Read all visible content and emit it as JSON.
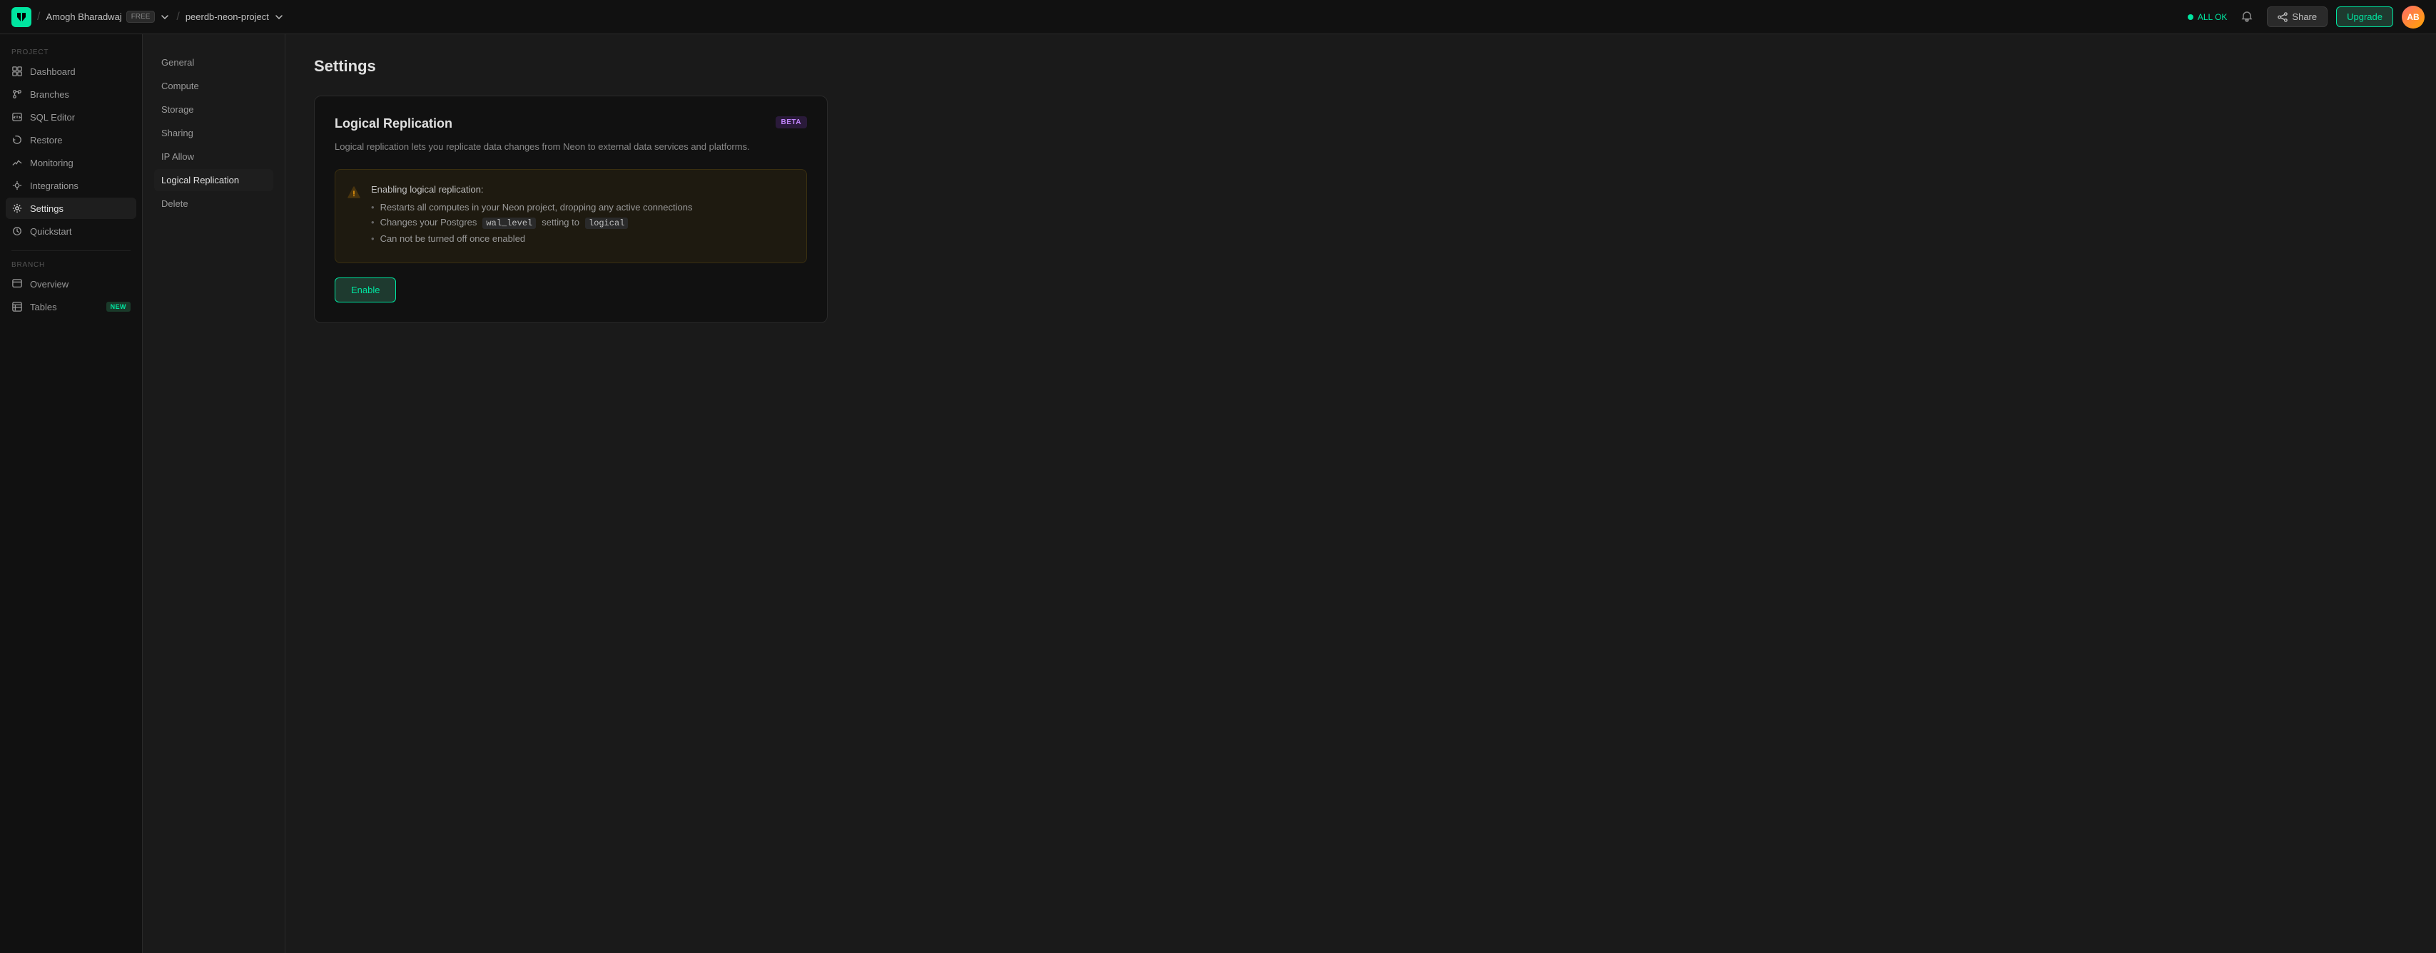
{
  "topNav": {
    "logo": "N",
    "user": {
      "name": "Amogh Bharadwaj",
      "badge": "FREE"
    },
    "project": {
      "name": "peerdb-neon-project"
    },
    "status": {
      "label": "ALL OK",
      "dot_color": "#00e5a0"
    },
    "share_label": "Share",
    "upgrade_label": "Upgrade",
    "avatar_initials": "AB"
  },
  "sidebar": {
    "project_label": "PROJECT",
    "branch_label": "BRANCH",
    "items_project": [
      {
        "id": "dashboard",
        "label": "Dashboard",
        "icon": "dashboard"
      },
      {
        "id": "branches",
        "label": "Branches",
        "icon": "branches"
      },
      {
        "id": "sql-editor",
        "label": "SQL Editor",
        "icon": "sql-editor"
      },
      {
        "id": "restore",
        "label": "Restore",
        "icon": "restore"
      },
      {
        "id": "monitoring",
        "label": "Monitoring",
        "icon": "monitoring"
      },
      {
        "id": "integrations",
        "label": "Integrations",
        "icon": "integrations"
      },
      {
        "id": "settings",
        "label": "Settings",
        "icon": "settings",
        "active": true
      }
    ],
    "items_extra": [
      {
        "id": "quickstart",
        "label": "Quickstart",
        "icon": "quickstart"
      }
    ],
    "items_branch": [
      {
        "id": "overview",
        "label": "Overview",
        "icon": "overview"
      },
      {
        "id": "tables",
        "label": "Tables",
        "icon": "tables",
        "badge": "NEW"
      }
    ]
  },
  "settings": {
    "title": "Settings",
    "nav_items": [
      {
        "id": "general",
        "label": "General"
      },
      {
        "id": "compute",
        "label": "Compute"
      },
      {
        "id": "storage",
        "label": "Storage"
      },
      {
        "id": "sharing",
        "label": "Sharing"
      },
      {
        "id": "ip-allow",
        "label": "IP Allow"
      },
      {
        "id": "logical-replication",
        "label": "Logical Replication",
        "active": true
      },
      {
        "id": "delete",
        "label": "Delete"
      }
    ],
    "logical_replication": {
      "title": "Logical Replication",
      "badge": "BETA",
      "description": "Logical replication lets you replicate data changes from Neon to external data services and platforms.",
      "warning": {
        "label": "Enabling logical replication:",
        "items": [
          "Restarts all computes in your Neon project, dropping any active connections",
          "Changes your Postgres wal_level setting to logical",
          "Can not be turned off once enabled"
        ],
        "code_terms": [
          "wal_level",
          "logical"
        ]
      },
      "enable_label": "Enable"
    }
  }
}
